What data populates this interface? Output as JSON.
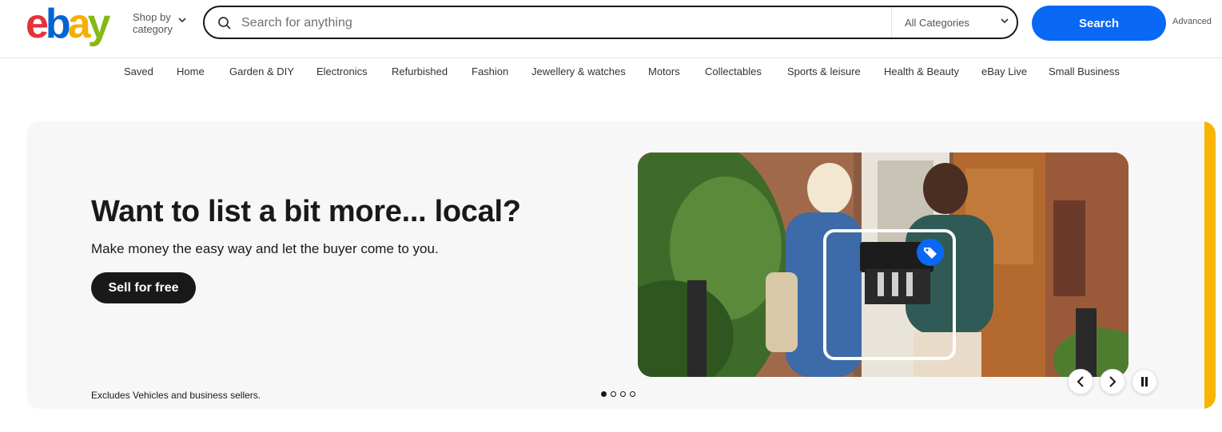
{
  "header": {
    "logo_letters": [
      "e",
      "b",
      "a",
      "y"
    ],
    "shop_by_label": "Shop by category",
    "search_placeholder": "Search for anything",
    "search_value": "",
    "category_selected": "All Categories",
    "search_button_label": "Search",
    "advanced_label": "Advanced"
  },
  "nav": {
    "items": [
      "Saved",
      "Home",
      "Garden & DIY",
      "Electronics",
      "Refurbished",
      "Fashion",
      "Jewellery & watches",
      "Motors",
      "Collectables",
      "Sports & leisure",
      "Health & Beauty",
      "eBay Live",
      "Small Business"
    ]
  },
  "hero": {
    "title": "Want to list a bit more... local?",
    "subtitle": "Make money the easy way and let the buyer come to you.",
    "cta_label": "Sell for free",
    "disclaimer": "Excludes Vehicles and business sellers.",
    "slide_count": 4,
    "active_slide": 1,
    "accent_color": "#f7b500"
  },
  "colors": {
    "logo_e": "#e53238",
    "logo_b": "#0064d2",
    "logo_a": "#f5af02",
    "logo_y": "#86b817",
    "search_button": "#0968f6"
  },
  "icons": {
    "search": "search-icon",
    "chevron": "chevron-down-icon",
    "prev": "chevron-left-icon",
    "next": "chevron-right-icon",
    "pause": "pause-icon",
    "tag": "tag-icon"
  }
}
